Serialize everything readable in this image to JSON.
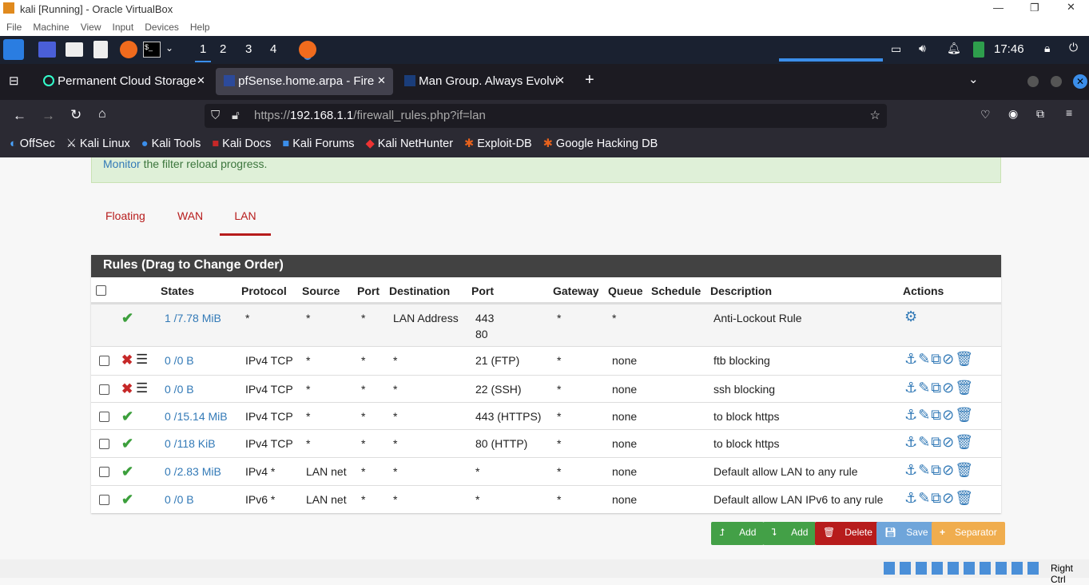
{
  "window": {
    "title": "kali [Running] - Oracle VirtualBox",
    "menu": [
      "File",
      "Machine",
      "View",
      "Input",
      "Devices",
      "Help"
    ]
  },
  "panel": {
    "workspaces": [
      "1",
      "2",
      "3",
      "4"
    ],
    "clock": "17:46"
  },
  "browser": {
    "tabs": [
      {
        "label": "Permanent Cloud Storage"
      },
      {
        "label": "pfSense.home.arpa - Fire"
      },
      {
        "label": "Man Group. Always Evolvi"
      }
    ],
    "url_prefix": "https://",
    "url_host": "192.168.1.1",
    "url_path": "/firewall_rules.php?if=lan",
    "bookmarks": [
      "OffSec",
      "Kali Linux",
      "Kali Tools",
      "Kali Docs",
      "Kali Forums",
      "Kali NetHunter",
      "Exploit-DB",
      "Google Hacking DB"
    ]
  },
  "alert": {
    "link": "Monitor",
    "text": " the filter reload progress."
  },
  "iface_tabs": [
    "Floating",
    "WAN",
    "LAN"
  ],
  "active_iface": "LAN",
  "table": {
    "title": "Rules (Drag to Change Order)",
    "headers": [
      "States",
      "Protocol",
      "Source",
      "Port",
      "Destination",
      "Port",
      "Gateway",
      "Queue",
      "Schedule",
      "Description",
      "Actions"
    ],
    "rows": [
      {
        "status": "pass",
        "states": "1 /7.78 MiB",
        "protocol": "*",
        "source": "*",
        "sport": "*",
        "dest": "LAN Address",
        "dport": "443",
        "dport2": "80",
        "gateway": "*",
        "queue": "*",
        "desc": "Anti-Lockout Rule"
      },
      {
        "status": "block",
        "states": "0 /0 B",
        "protocol": "IPv4 TCP",
        "source": "*",
        "sport": "*",
        "dest": "*",
        "dport": "21 (FTP)",
        "gateway": "*",
        "queue": "none",
        "desc": "ftb blocking"
      },
      {
        "status": "block",
        "states": "0 /0 B",
        "protocol": "IPv4 TCP",
        "source": "*",
        "sport": "*",
        "dest": "*",
        "dport": "22 (SSH)",
        "gateway": "*",
        "queue": "none",
        "desc": "ssh blocking"
      },
      {
        "status": "pass",
        "states": "0 /15.14 MiB",
        "protocol": "IPv4 TCP",
        "source": "*",
        "sport": "*",
        "dest": "*",
        "dport": "443 (HTTPS)",
        "gateway": "*",
        "queue": "none",
        "desc": "to block https"
      },
      {
        "status": "pass",
        "states": "0 /118 KiB",
        "protocol": "IPv4 TCP",
        "source": "*",
        "sport": "*",
        "dest": "*",
        "dport": "80 (HTTP)",
        "gateway": "*",
        "queue": "none",
        "desc": "to block https"
      },
      {
        "status": "pass",
        "states": "0 /2.83 MiB",
        "protocol": "IPv4 *",
        "source": "LAN net",
        "sport": "*",
        "dest": "*",
        "dport": "*",
        "gateway": "*",
        "queue": "none",
        "desc": "Default allow LAN to any rule"
      },
      {
        "status": "pass",
        "states": "0 /0 B",
        "protocol": "IPv6 *",
        "source": "LAN net",
        "sport": "*",
        "dest": "*",
        "dport": "*",
        "gateway": "*",
        "queue": "none",
        "desc": "Default allow LAN IPv6 to any rule"
      }
    ]
  },
  "buttons": {
    "add_top": "Add",
    "add_bottom": "Add",
    "delete": "Delete",
    "save": "Save",
    "separator": "Separator"
  },
  "statusbar": {
    "host_key": "Right Ctrl"
  },
  "colors": {
    "pass": "#3c9f3c",
    "block": "#c62828",
    "accent": "#b71c1c",
    "link": "#337ab7"
  }
}
